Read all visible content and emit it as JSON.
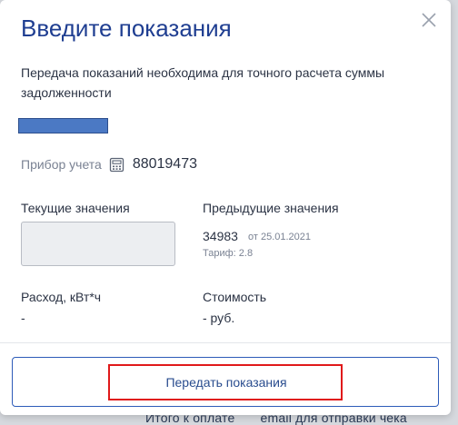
{
  "backdrop": {
    "left_text": "Итого к оплате",
    "right_text": "email для отправки чека"
  },
  "dialog": {
    "title": "Введите показания",
    "subtitle": "Передача показаний необходима для точного расчета суммы задолженности",
    "close_icon": "close-icon",
    "meter": {
      "label": "Прибор учета",
      "icon": "meter-icon",
      "number": "88019473"
    },
    "current": {
      "label": "Текущие значения",
      "value": ""
    },
    "previous": {
      "label": "Предыдущие значения",
      "value": "34983",
      "date": "от 25.01.2021",
      "tariff": "Тариф: 2.8"
    },
    "consumption": {
      "label": "Расход, кВт*ч",
      "value": "-"
    },
    "cost": {
      "label": "Стоимость",
      "value": "- руб."
    },
    "submit_label": "Передать показания"
  },
  "colors": {
    "title": "#1f3e91",
    "button_border": "#2d5bb8",
    "highlight": "#e0191a",
    "redacted_fill": "#4b79c4"
  }
}
